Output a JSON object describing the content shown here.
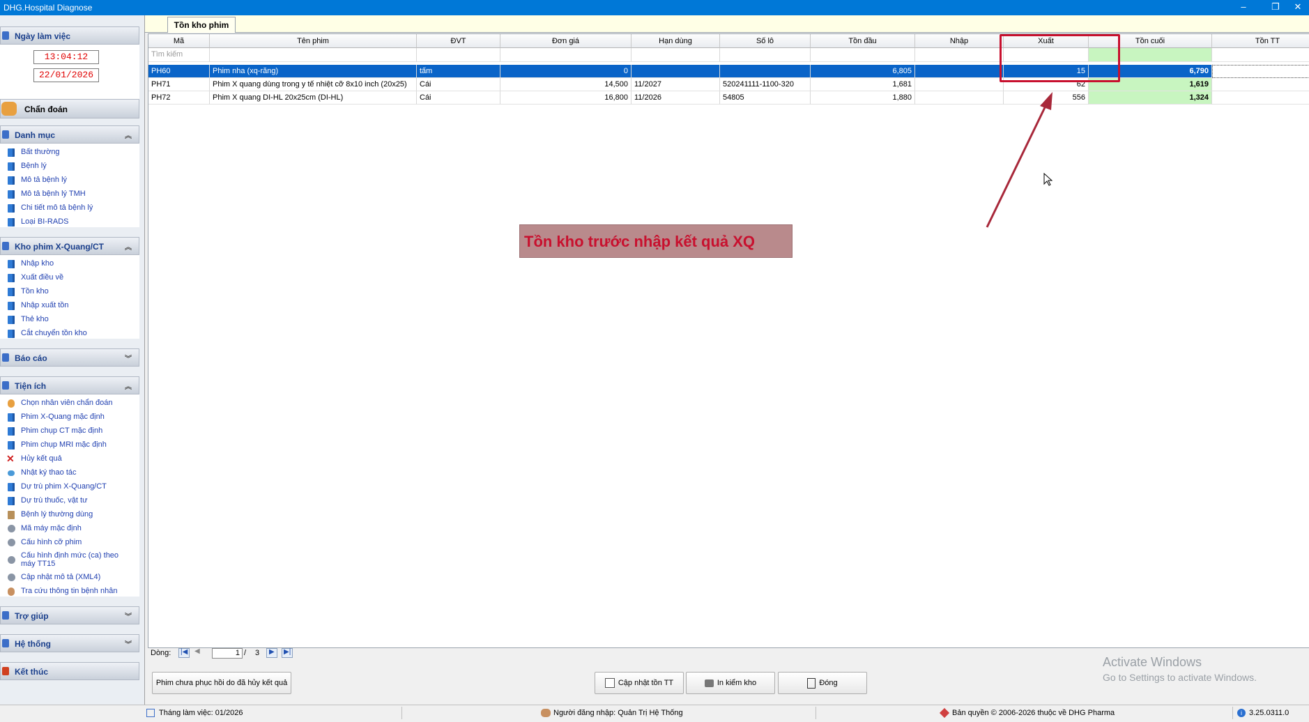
{
  "window": {
    "title": "DHG.Hospital Diagnose",
    "minimize": "–",
    "restore": "❐",
    "close": "✕"
  },
  "sidebar": {
    "workday_label": "Ngày làm việc",
    "time": "13:04:12",
    "date": "22/01/2026",
    "diagnose_label": "Chẩn đoán",
    "sections": {
      "catalog": {
        "label": "Danh mục",
        "items": [
          "Bất thường",
          "Bệnh lý",
          "Mô tả bệnh lý",
          "Mô tả bệnh lý TMH",
          "Chi tiết mô tả bệnh lý",
          "Loại BI-RADS"
        ]
      },
      "film_stock": {
        "label": "Kho phim X-Quang/CT",
        "items": [
          "Nhập kho",
          "Xuất điều về",
          "Tồn kho",
          "Nhập xuất tồn",
          "Thẻ kho",
          "Cắt chuyển tồn kho"
        ]
      },
      "report": {
        "label": "Báo cáo"
      },
      "utilities": {
        "label": "Tiện ích",
        "items": [
          "Chọn nhân viên chẩn đoán",
          "Phim X-Quang mặc định",
          "Phim chụp CT mặc định",
          "Phim chụp MRI mặc định",
          "Hủy kết quả",
          "Nhật ký thao tác",
          "Dự trù phim X-Quang/CT",
          "Dự trù thuốc, vật tư",
          "Bệnh lý thường dùng",
          "Mã máy mặc định",
          "Cấu hình cỡ phim",
          "Cấu hình định mức (ca) theo máy TT15",
          "Cập nhật mô tả (XML4)",
          "Tra cứu thông tin bệnh nhân"
        ]
      },
      "help": {
        "label": "Trợ giúp"
      },
      "system": {
        "label": "Hệ thống"
      },
      "exit": {
        "label": "Kết thúc"
      }
    }
  },
  "tab": {
    "label": "Tồn kho phim"
  },
  "grid": {
    "columns": [
      "Mã",
      "Tên phim",
      "ĐVT",
      "Đơn giá",
      "Hạn dùng",
      "Số lô",
      "Tồn đầu",
      "Nhập",
      "Xuất",
      "Tồn cuối",
      "Tồn TT"
    ],
    "search_placeholder": "Tìm kiếm",
    "rows": [
      {
        "ma": "PH60",
        "ten": "Phim nha (xq-răng)",
        "dvt": "tấm",
        "don_gia": "0",
        "han_dung": "",
        "so_lo": "",
        "ton_dau": "6,805",
        "nhap": "",
        "xuat": "15",
        "ton_cuoi": "6,790",
        "ton_tt": ""
      },
      {
        "ma": "PH71",
        "ten": "Phim X quang dùng trong y tế nhiệt cỡ 8x10 inch (20x25)",
        "dvt": "Cái",
        "don_gia": "14,500",
        "han_dung": "11/2027",
        "so_lo": "520241111-1100-320",
        "ton_dau": "1,681",
        "nhap": "",
        "xuat": "62",
        "ton_cuoi": "1,619",
        "ton_tt": ""
      },
      {
        "ma": "PH72",
        "ten": "Phim X quang DI-HL 20x25cm (DI-HL)",
        "dvt": "Cái",
        "don_gia": "16,800",
        "han_dung": "11/2026",
        "so_lo": "54805",
        "ton_dau": "1,880",
        "nhap": "",
        "xuat": "556",
        "ton_cuoi": "1,324",
        "ton_tt": ""
      }
    ]
  },
  "annotation": {
    "text": "Tồn kho trước nhập kết quả XQ"
  },
  "pager": {
    "label": "Dòng:",
    "current": "1",
    "separator": "/",
    "total": "3"
  },
  "buttons": {
    "restore_film": "Phim chưa phục hồi do đã hủy kết quả",
    "update_stock": "Cập nhật tồn TT",
    "print_check": "In kiểm kho",
    "close": "Đóng"
  },
  "watermark": {
    "line1": "Activate Windows",
    "line2": "Go to Settings to activate Windows."
  },
  "status": {
    "month": "Tháng làm việc: 01/2026",
    "user": "Người đăng nhập: Quản Trị Hệ Thống",
    "copyright": "Bản quyền © 2006-2026 thuộc về DHG Pharma",
    "version": "3.25.0311.0"
  },
  "colors": {
    "titlebar": "#0078d7",
    "selection": "#0a64c8",
    "highlight_green": "#c8f5c0",
    "annotation_red": "#c8102e",
    "annotation_bg": "#b98a8c"
  }
}
